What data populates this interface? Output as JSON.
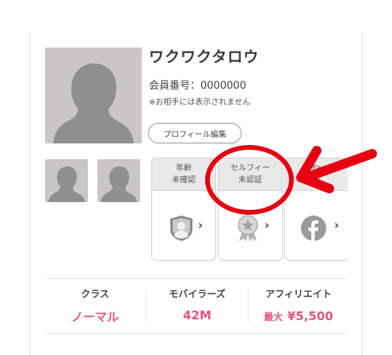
{
  "profile": {
    "name": "ワクワクタロウ",
    "member_number": "会員番号：0000000",
    "hidden_note": "※お相手には表示されません",
    "edit_button": "プロフィール編集"
  },
  "badges": [
    {
      "line1": "年齢",
      "line2": "未確認",
      "icon": "shield-user-icon"
    },
    {
      "line1": "セルフィー",
      "line2": "未認証",
      "icon": "medal-star-icon"
    },
    {
      "line1": "Fa",
      "line2": "未",
      "icon": "facebook-icon"
    }
  ],
  "chevron": "›",
  "stats": [
    {
      "label": "クラス",
      "value": "ノーマル"
    },
    {
      "label": "モバイラーズ",
      "value": "42M"
    },
    {
      "label": "アフィリエイト",
      "value_prefix": "最大",
      "value": "¥5,500"
    }
  ],
  "colors": {
    "accent_pink": "#e8557f",
    "annotation_red": "#e60012",
    "placeholder_gray": "#c9c6c6"
  }
}
